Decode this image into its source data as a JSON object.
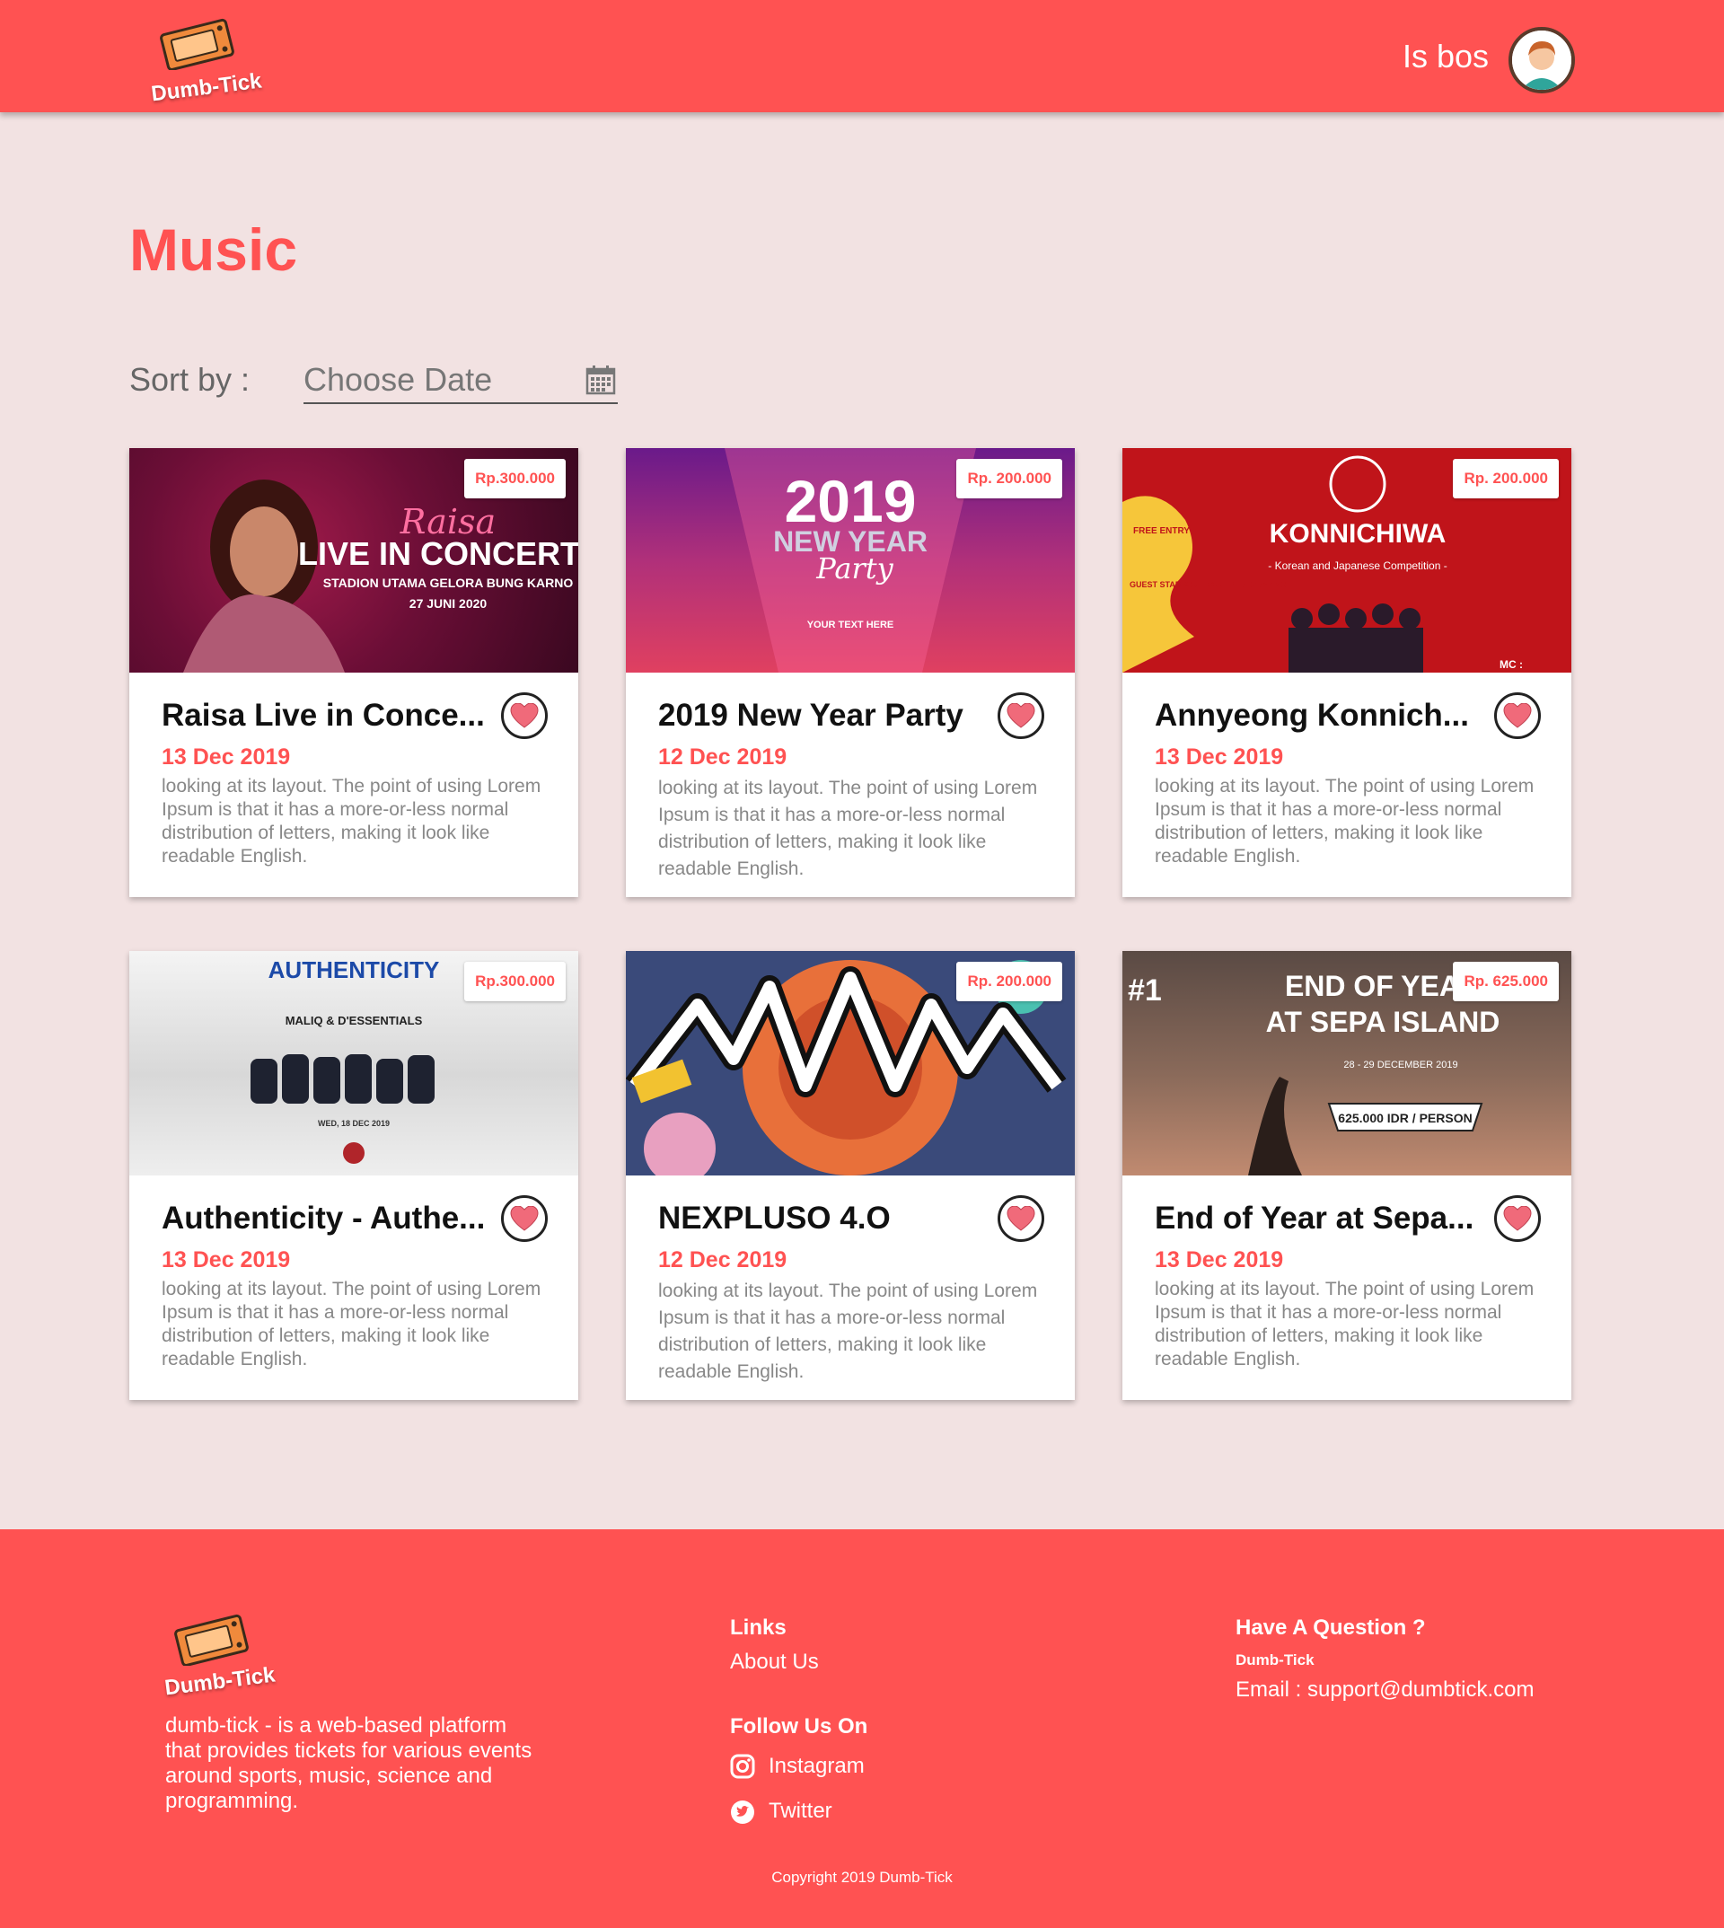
{
  "header": {
    "logo_text": "Dumb-Tick",
    "user_name": "Is bos"
  },
  "page": {
    "title": "Music",
    "sort_label": "Sort by :",
    "date_placeholder": "Choose Date"
  },
  "events": [
    {
      "price": "Rp.300.000",
      "title": "Raisa Live in Conce...",
      "date": "13 Dec 2019",
      "description": "looking at its layout.  The point of using Lorem Ipsum is that it has a more-or-less normal distribution of letters, making it look like readable English."
    },
    {
      "price": "Rp. 200.000",
      "title": "2019 New Year Party",
      "date": "12 Dec 2019",
      "description": "looking at its layout.  The point of using Lorem Ipsum is that it has a more-or-less normal distribution of letters, making it look like readable English."
    },
    {
      "price": "Rp. 200.000",
      "title": "Annyeong Konnich...",
      "date": "13 Dec 2019",
      "description": "looking at its layout.  The point of using Lorem Ipsum is that it has a more-or-less normal distribution of letters, making it look like readable English."
    },
    {
      "price": "Rp.300.000",
      "title": "Authenticity - Authe...",
      "date": "13 Dec 2019",
      "description": "looking at its layout.  The point of using Lorem Ipsum is that it has a more-or-less normal distribution of letters, making it look like readable English."
    },
    {
      "price": "Rp. 200.000",
      "title": "NEXPLUSO 4.O",
      "date": "12 Dec 2019",
      "description": "looking at its layout.  The point of using Lorem Ipsum is that it has a more-or-less normal distribution of letters, making it look like readable English."
    },
    {
      "price": "Rp. 625.000",
      "title": "End of Year at Sepa...",
      "date": "13 Dec 2019",
      "description": "looking at its layout.  The point of using Lorem Ipsum is that it has a more-or-less normal distribution of letters, making it look like readable English."
    }
  ],
  "posters": {
    "raisa": {
      "script": "Raisa",
      "line1": "LIVE IN CONCERT",
      "line2": "STADION UTAMA GELORA BUNG KARNO",
      "line3": "27 JUNI 2020"
    },
    "newyear": {
      "year": "2019",
      "line1": "NEW YEAR",
      "line2": "Party",
      "line3": "YOUR TEXT HERE"
    },
    "annyeong": {
      "line1": "KONNICHIWA",
      "line2": "- Korean and Japanese Competition -",
      "tag1": "FREE ENTRY",
      "tag2": "GUEST STAR & SPECIAL PERFORMANCE",
      "tag3": "MC :"
    },
    "authenticity": {
      "line1": "AUTHENTICITY",
      "line2": "MALIQ & D'ESSENTIALS",
      "line3": "WED, 18 DEC 2019"
    },
    "sepa": {
      "badge": "#1",
      "line1": "END OF YEAR",
      "line2": "AT SEPA ISLAND",
      "line3": "28 - 29 DECEMBER 2019",
      "line4": "625.000 IDR / PERSON"
    }
  },
  "footer": {
    "logo_text": "Dumb-Tick",
    "about": "dumb-tick - is a web-based platform that provides tickets for various events around sports, music, science and programming.",
    "links_heading": "Links",
    "about_us": "About Us",
    "follow_heading": "Follow Us On",
    "instagram": "Instagram",
    "twitter": "Twitter",
    "question_heading": "Have A Question ?",
    "brand": "Dumb-Tick",
    "email": "Email : support@dumbtick.com",
    "copyright": "Copyright 2019 Dumb-Tick"
  },
  "colors": {
    "accent": "#ff5252",
    "background": "#f2e2e2"
  },
  "icons": [
    "ticket-icon",
    "avatar",
    "calendar-icon",
    "heart-icon",
    "instagram-icon",
    "twitter-icon"
  ]
}
